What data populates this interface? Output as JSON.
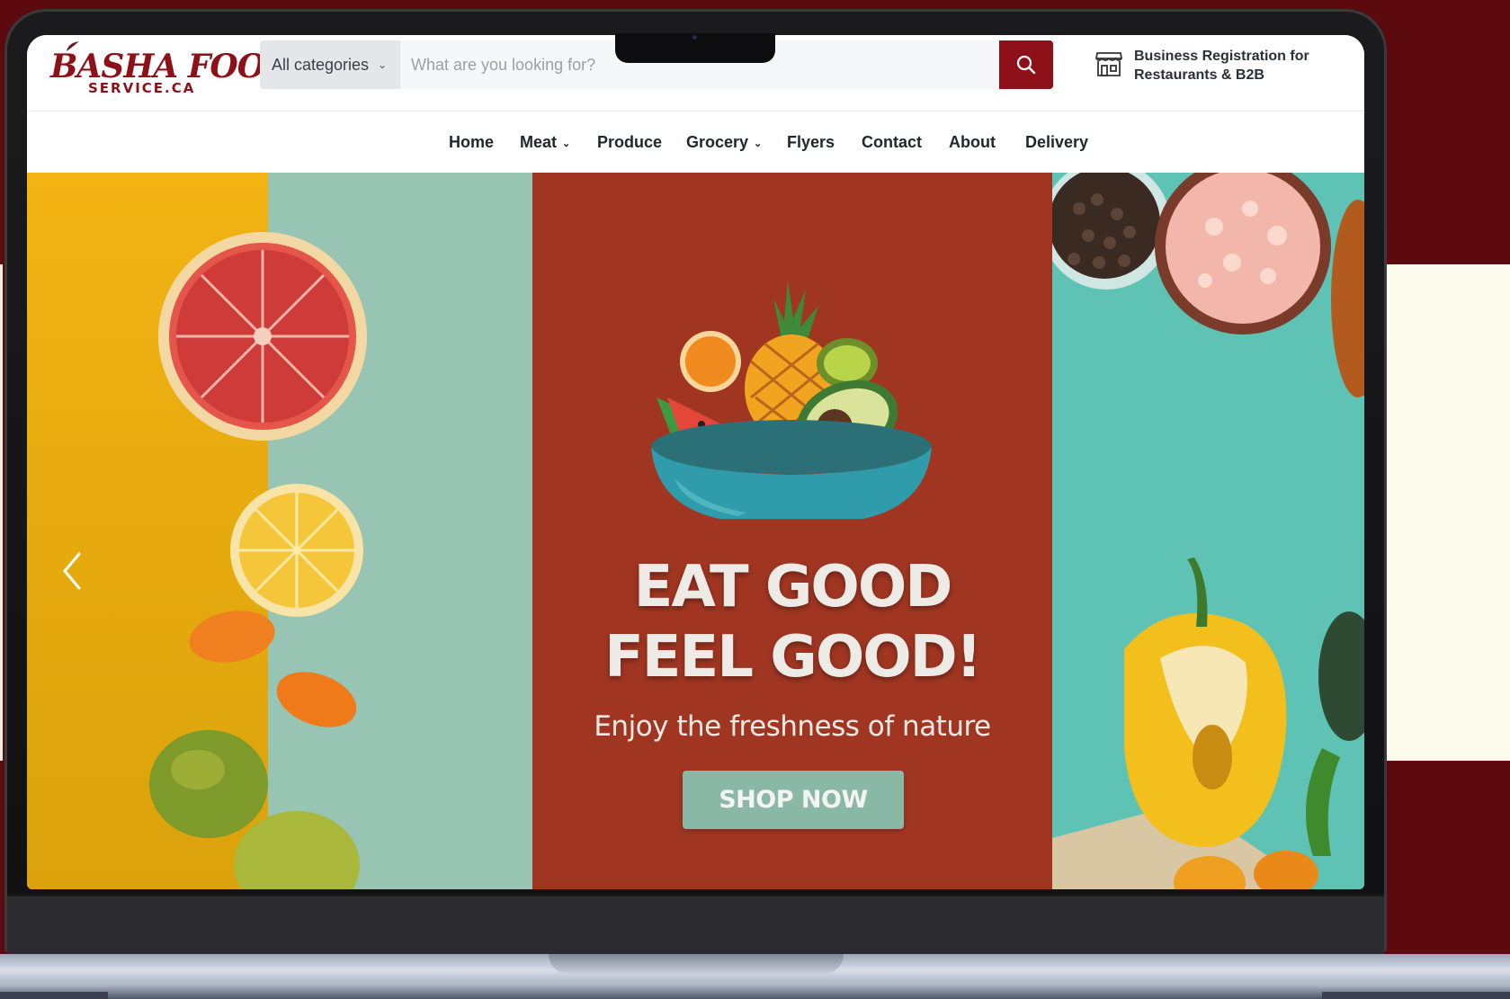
{
  "brand": {
    "logo_main": "BASHA FOODS",
    "logo_sub": "SERVICE.CA",
    "accent": "#8e1119"
  },
  "search": {
    "category_label": "All categories",
    "placeholder": "What are you looking for?",
    "value": ""
  },
  "b2b": {
    "line1": "Business Registration for",
    "line2": "Restaurants & B2B",
    "icon": "storefront-icon"
  },
  "nav": {
    "items": [
      {
        "label": "Home",
        "dropdown": false
      },
      {
        "label": "Meat",
        "dropdown": true
      },
      {
        "label": "Produce",
        "dropdown": false
      },
      {
        "label": "Grocery",
        "dropdown": true
      },
      {
        "label": "Flyers",
        "dropdown": false
      },
      {
        "label": "Contact",
        "dropdown": false
      },
      {
        "label": "About",
        "dropdown": false
      },
      {
        "label": "Delivery",
        "dropdown": false
      }
    ]
  },
  "hero": {
    "headline_line1": "EAT GOOD",
    "headline_line2": "FEEL GOOD!",
    "subline": "Enjoy the freshness of nature",
    "cta": "SHOP NOW",
    "colors": {
      "center": "#a03622",
      "cta": "#89b9a6",
      "left_yellow": "#f2b313",
      "left_mint": "#97c4b3",
      "right_teal": "#5ec2b5"
    }
  }
}
